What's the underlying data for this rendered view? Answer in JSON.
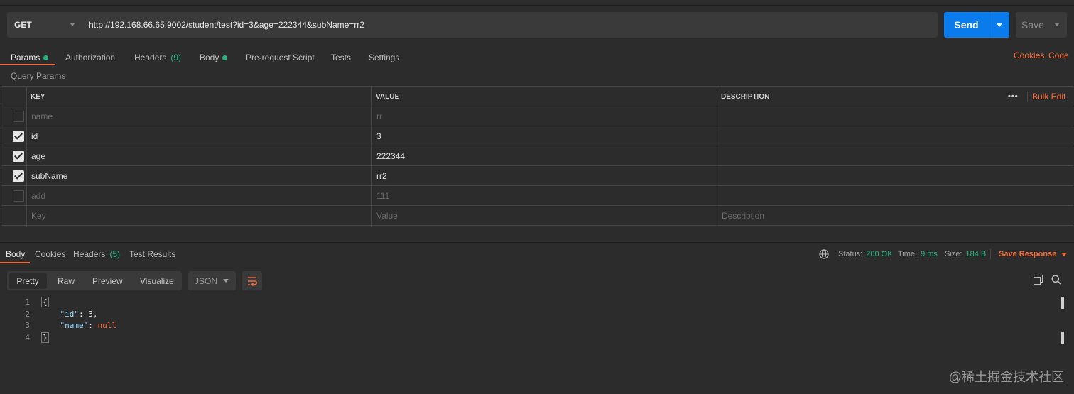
{
  "request": {
    "method": "GET",
    "url": "http://192.168.66.65:9002/student/test?id=3&age=222344&subName=rr2",
    "send_label": "Send",
    "save_label": "Save"
  },
  "tabs": [
    {
      "label": "Params",
      "active": true,
      "dot": true
    },
    {
      "label": "Authorization"
    },
    {
      "label": "Headers",
      "count": "(9)"
    },
    {
      "label": "Body",
      "dot": true
    },
    {
      "label": "Pre-request Script"
    },
    {
      "label": "Tests"
    },
    {
      "label": "Settings"
    }
  ],
  "right_links": {
    "cookies": "Cookies",
    "code": "Code"
  },
  "query_params": {
    "title": "Query Params",
    "headers": {
      "key": "KEY",
      "value": "VALUE",
      "description": "DESCRIPTION",
      "more": "•••",
      "bulk_edit": "Bulk Edit"
    },
    "rows": [
      {
        "key": "name",
        "value": "rr",
        "checked": false
      },
      {
        "key": "id",
        "value": "3",
        "checked": true
      },
      {
        "key": "age",
        "value": "222344",
        "checked": true
      },
      {
        "key": "subName",
        "value": "rr2",
        "checked": true
      },
      {
        "key": "add",
        "value": "111",
        "checked": false
      }
    ],
    "placeholders": {
      "key": "Key",
      "value": "Value",
      "description": "Description"
    }
  },
  "response": {
    "tabs": [
      {
        "label": "Body",
        "active": true
      },
      {
        "label": "Cookies"
      },
      {
        "label": "Headers",
        "count": "(5)"
      },
      {
        "label": "Test Results"
      }
    ],
    "status_label": "Status:",
    "status_value": "200 OK",
    "time_label": "Time:",
    "time_value": "9 ms",
    "size_label": "Size:",
    "size_value": "184 B",
    "save_response": "Save Response",
    "views": [
      "Pretty",
      "Raw",
      "Preview",
      "Visualize"
    ],
    "format": "JSON",
    "line_numbers": [
      "1",
      "2",
      "3",
      "4"
    ],
    "json": {
      "open": "{",
      "id_key": "\"id\"",
      "id_value": "3",
      "name_key": "\"name\"",
      "name_value": "null",
      "close": "}"
    }
  },
  "watermark": "@稀土掘金技术社区",
  "colors": {
    "accent": "#f26b3a",
    "send": "#097bed",
    "success": "#26b47f",
    "background": "#2c2c2c"
  }
}
